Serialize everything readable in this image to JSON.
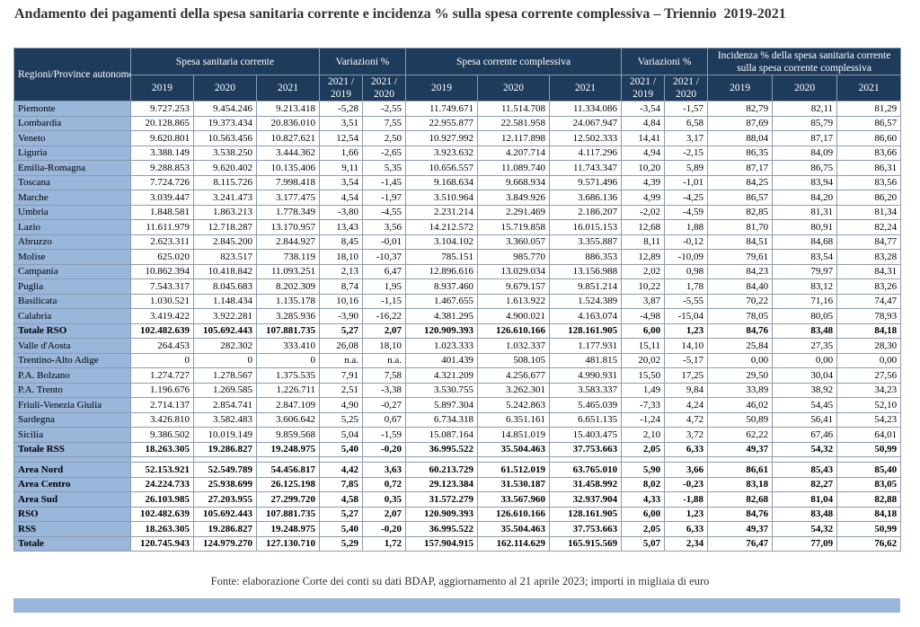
{
  "title": "Andamento dei pagamenti della spesa sanitaria corrente e incidenza % sulla spesa corrente complessiva – Triennio",
  "title_years": "2019-2021",
  "headers": {
    "region": "Regioni/Province autonome",
    "groups": [
      "Spesa sanitaria corrente",
      "Variazioni %",
      "Spesa corrente complessiva",
      "Variazioni %",
      "Incidenza % della spesa sanitaria corrente sulla spesa corrente complessiva"
    ],
    "sub": [
      "2019",
      "2020",
      "2021",
      "2021 / 2019",
      "2021 / 2020",
      "2019",
      "2020",
      "2021",
      "2021 / 2019",
      "2021 / 2020",
      "2019",
      "2020",
      "2021"
    ]
  },
  "rows": [
    {
      "name": "Piemonte",
      "values": [
        "9.727.253",
        "9.454.246",
        "9.213.418",
        "-5,28",
        "-2,55",
        "11.749.671",
        "11.514.708",
        "11.334.086",
        "-3,54",
        "-1,57",
        "82,79",
        "82,11",
        "81,29"
      ]
    },
    {
      "name": "Lombardia",
      "values": [
        "20.128.865",
        "19.373.434",
        "20.836.010",
        "3,51",
        "7,55",
        "22.955.877",
        "22.581.958",
        "24.067.947",
        "4,84",
        "6,58",
        "87,69",
        "85,79",
        "86,57"
      ]
    },
    {
      "name": "Veneto",
      "values": [
        "9.620.801",
        "10.563.456",
        "10.827.621",
        "12,54",
        "2,50",
        "10.927.992",
        "12.117.898",
        "12.502.333",
        "14,41",
        "3,17",
        "88,04",
        "87,17",
        "86,60"
      ]
    },
    {
      "name": "Liguria",
      "values": [
        "3.388.149",
        "3.538.250",
        "3.444.362",
        "1,66",
        "-2,65",
        "3.923.632",
        "4.207.714",
        "4.117.296",
        "4,94",
        "-2,15",
        "86,35",
        "84,09",
        "83,66"
      ]
    },
    {
      "name": "Emilia-Romagna",
      "values": [
        "9.288.853",
        "9.620.402",
        "10.135.406",
        "9,11",
        "5,35",
        "10.656.557",
        "11.089.740",
        "11.743.347",
        "10,20",
        "5,89",
        "87,17",
        "86,75",
        "86,31"
      ]
    },
    {
      "name": "Toscana",
      "values": [
        "7.724.726",
        "8.115.726",
        "7.998.418",
        "3,54",
        "-1,45",
        "9.168.634",
        "9.668.934",
        "9.571.496",
        "4,39",
        "-1,01",
        "84,25",
        "83,94",
        "83,56"
      ]
    },
    {
      "name": "Marche",
      "values": [
        "3.039.447",
        "3.241.473",
        "3.177.475",
        "4,54",
        "-1,97",
        "3.510.964",
        "3.849.926",
        "3.686.136",
        "4,99",
        "-4,25",
        "86,57",
        "84,20",
        "86,20"
      ]
    },
    {
      "name": "Umbria",
      "values": [
        "1.848.581",
        "1.863.213",
        "1.778.349",
        "-3,80",
        "-4,55",
        "2.231.214",
        "2.291.469",
        "2.186.207",
        "-2,02",
        "-4,59",
        "82,85",
        "81,31",
        "81,34"
      ]
    },
    {
      "name": "Lazio",
      "values": [
        "11.611.979",
        "12.718.287",
        "13.170.957",
        "13,43",
        "3,56",
        "14.212.572",
        "15.719.858",
        "16.015.153",
        "12,68",
        "1,88",
        "81,70",
        "80,91",
        "82,24"
      ]
    },
    {
      "name": "Abruzzo",
      "values": [
        "2.623.311",
        "2.845.200",
        "2.844.927",
        "8,45",
        "-0,01",
        "3.104.102",
        "3.360.057",
        "3.355.887",
        "8,11",
        "-0,12",
        "84,51",
        "84,68",
        "84,77"
      ]
    },
    {
      "name": "Molise",
      "values": [
        "625.020",
        "823.517",
        "738.119",
        "18,10",
        "-10,37",
        "785.151",
        "985.770",
        "886.353",
        "12,89",
        "-10,09",
        "79,61",
        "83,54",
        "83,28"
      ]
    },
    {
      "name": "Campania",
      "values": [
        "10.862.394",
        "10.418.842",
        "11.093.251",
        "2,13",
        "6,47",
        "12.896.616",
        "13.029.034",
        "13.156.988",
        "2,02",
        "0,98",
        "84,23",
        "79,97",
        "84,31"
      ]
    },
    {
      "name": "Puglia",
      "values": [
        "7.543.317",
        "8.045.683",
        "8.202.309",
        "8,74",
        "1,95",
        "8.937.460",
        "9.679.157",
        "9.851.214",
        "10,22",
        "1,78",
        "84,40",
        "83,12",
        "83,26"
      ]
    },
    {
      "name": "Basilicata",
      "values": [
        "1.030.521",
        "1.148.434",
        "1.135.178",
        "10,16",
        "-1,15",
        "1.467.655",
        "1.613.922",
        "1.524.389",
        "3,87",
        "-5,55",
        "70,22",
        "71,16",
        "74,47"
      ]
    },
    {
      "name": "Calabria",
      "values": [
        "3.419.422",
        "3.922.281",
        "3.285.936",
        "-3,90",
        "-16,22",
        "4.381.295",
        "4.900.021",
        "4.163.074",
        "-4,98",
        "-15,04",
        "78,05",
        "80,05",
        "78,93"
      ]
    },
    {
      "name": "Totale RSO",
      "bold": true,
      "values": [
        "102.482.639",
        "105.692.443",
        "107.881.735",
        "5,27",
        "2,07",
        "120.909.393",
        "126.610.166",
        "128.161.905",
        "6,00",
        "1,23",
        "84,76",
        "83,48",
        "84,18"
      ]
    },
    {
      "name": "Valle d'Aosta",
      "values": [
        "264.453",
        "282.302",
        "333.410",
        "26,08",
        "18,10",
        "1.023.333",
        "1.032.337",
        "1.177.931",
        "15,11",
        "14,10",
        "25,84",
        "27,35",
        "28,30"
      ]
    },
    {
      "name": "Trentino-Alto Adige",
      "values": [
        "0",
        "0",
        "0",
        "n.a.",
        "n.a.",
        "401.439",
        "508.105",
        "481.815",
        "20,02",
        "-5,17",
        "0,00",
        "0,00",
        "0,00"
      ]
    },
    {
      "name": "P.A. Bolzano",
      "values": [
        "1.274.727",
        "1.278.567",
        "1.375.535",
        "7,91",
        "7,58",
        "4.321.209",
        "4.256.677",
        "4.990.931",
        "15,50",
        "17,25",
        "29,50",
        "30,04",
        "27,56"
      ]
    },
    {
      "name": "P.A. Trento",
      "values": [
        "1.196.676",
        "1.269.585",
        "1.226.711",
        "2,51",
        "-3,38",
        "3.530.755",
        "3.262.301",
        "3.583.337",
        "1,49",
        "9,84",
        "33,89",
        "38,92",
        "34,23"
      ]
    },
    {
      "name": "Friuli-Venezia Giulia",
      "values": [
        "2.714.137",
        "2.854.741",
        "2.847.109",
        "4,90",
        "-0,27",
        "5.897.304",
        "5.242.863",
        "5.465.039",
        "-7,33",
        "4,24",
        "46,02",
        "54,45",
        "52,10"
      ]
    },
    {
      "name": "Sardegna",
      "values": [
        "3.426.810",
        "3.582.483",
        "3.606.642",
        "5,25",
        "0,67",
        "6.734.318",
        "6.351.161",
        "6.651.135",
        "-1,24",
        "4,72",
        "50,89",
        "56,41",
        "54,23"
      ]
    },
    {
      "name": "Sicilia",
      "values": [
        "9.386.502",
        "10.019.149",
        "9.859.568",
        "5,04",
        "-1,59",
        "15.087.164",
        "14.851.019",
        "15.403.475",
        "2,10",
        "3,72",
        "62,22",
        "67,46",
        "64,01"
      ]
    },
    {
      "name": "Totale RSS",
      "bold": true,
      "values": [
        "18.263.305",
        "19.286.827",
        "19.248.975",
        "5,40",
        "-0,20",
        "36.995.522",
        "35.504.463",
        "37.753.663",
        "2,05",
        "6,33",
        "49,37",
        "54,32",
        "50,99"
      ]
    }
  ],
  "summary": [
    {
      "name": "Area Nord",
      "values": [
        "52.153.921",
        "52.549.789",
        "54.456.817",
        "4,42",
        "3,63",
        "60.213.729",
        "61.512.019",
        "63.765.010",
        "5,90",
        "3,66",
        "86,61",
        "85,43",
        "85,40"
      ]
    },
    {
      "name": "Area Centro",
      "values": [
        "24.224.733",
        "25.938.699",
        "26.125.198",
        "7,85",
        "0,72",
        "29.123.384",
        "31.530.187",
        "31.458.992",
        "8,02",
        "-0,23",
        "83,18",
        "82,27",
        "83,05"
      ]
    },
    {
      "name": "Area Sud",
      "values": [
        "26.103.985",
        "27.203.955",
        "27.299.720",
        "4,58",
        "0,35",
        "31.572.279",
        "33.567.960",
        "32.937.904",
        "4,33",
        "-1,88",
        "82,68",
        "81,04",
        "82,88"
      ]
    },
    {
      "name": "RSO",
      "values": [
        "102.482.639",
        "105.692.443",
        "107.881.735",
        "5,27",
        "2,07",
        "120.909.393",
        "126.610.166",
        "128.161.905",
        "6,00",
        "1,23",
        "84,76",
        "83,48",
        "84,18"
      ]
    },
    {
      "name": "RSS",
      "values": [
        "18.263.305",
        "19.286.827",
        "19.248.975",
        "5,40",
        "-0,20",
        "36.995.522",
        "35.504.463",
        "37.753.663",
        "2,05",
        "6,33",
        "49,37",
        "54,32",
        "50,99"
      ]
    },
    {
      "name": "Totale",
      "values": [
        "120.745.943",
        "124.979.270",
        "127.130.710",
        "5,29",
        "1,72",
        "157.904.915",
        "162.114.629",
        "165.915.569",
        "5,07",
        "2,34",
        "76,47",
        "77,09",
        "76,62"
      ]
    }
  ],
  "source": "Fonte: elaborazione Corte dei conti su dati BDAP, aggiornamento al 21 aprile 2023; importi in migliaia di euro",
  "colors": {
    "header_bg": "#1f3b5b",
    "region_bg": "#9ab6db",
    "border": "#8a9bb3"
  }
}
